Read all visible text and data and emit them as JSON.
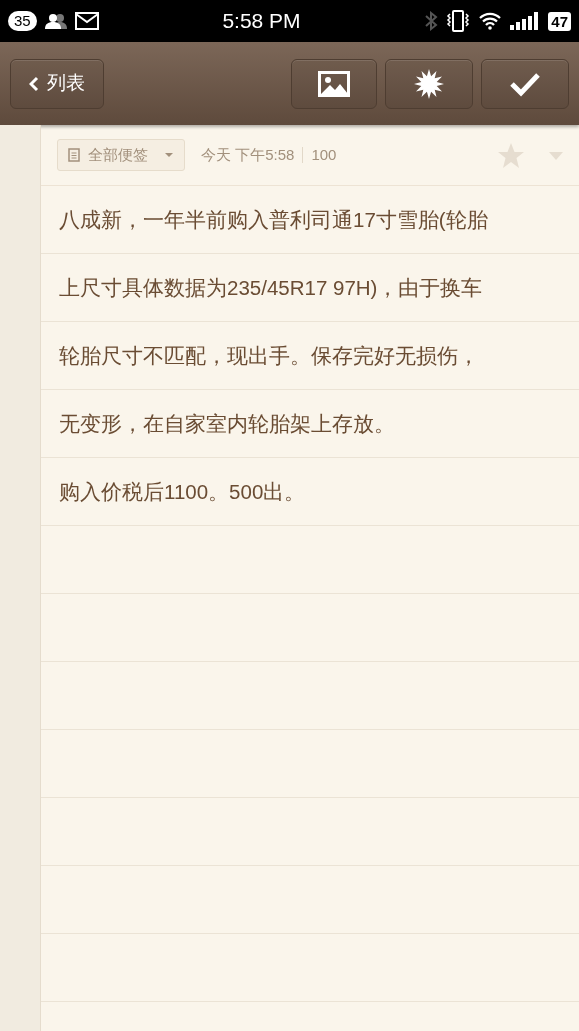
{
  "status_bar": {
    "notification_count": "35",
    "time": "5:58 PM",
    "battery": "47"
  },
  "toolbar": {
    "back_label": "列表"
  },
  "note": {
    "folder": "全部便签",
    "date": "今天 下午5:58",
    "word_count": "100",
    "starred": false,
    "lines": [
      "八成新，一年半前购入普利司通17寸雪胎(轮胎",
      "上尺寸具体数据为235/45R17 97H)，由于换车",
      "轮胎尺寸不匹配，现出手。保存完好无损伤，",
      "无变形，在自家室内轮胎架上存放。",
      "购入价税后1100。500出。"
    ]
  }
}
